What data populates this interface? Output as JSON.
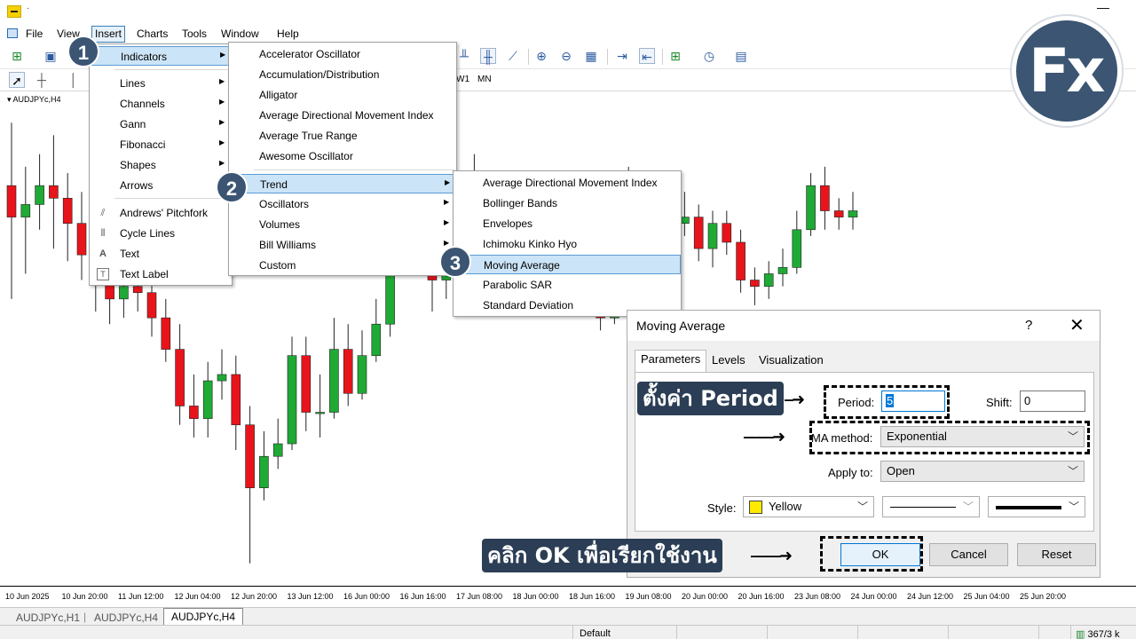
{
  "app": {
    "title_mark": "·"
  },
  "menubar": {
    "items": [
      "File",
      "View",
      "Insert",
      "Charts",
      "Tools",
      "Window",
      "Help"
    ]
  },
  "toolbar": {
    "timeframes": [
      "W1",
      "MN"
    ]
  },
  "chart": {
    "symbol": "AUDJPYc,H4",
    "time_ticks": [
      "10 Jun 2025",
      "10 Jun 20:00",
      "11 Jun 12:00",
      "12 Jun 04:00",
      "12 Jun 20:00",
      "13 Jun 12:00",
      "16 Jun 00:00",
      "16 Jun 16:00",
      "17 Jun 08:00",
      "18 Jun 00:00",
      "18 Jun 16:00",
      "19 Jun 08:00",
      "20 Jun 00:00",
      "20 Jun 16:00",
      "23 Jun 08:00",
      "24 Jun 00:00",
      "24 Jun 12:00",
      "25 Jun 04:00",
      "25 Jun 20:00"
    ],
    "colors": {
      "bull": "#1faa35",
      "bear": "#e8141b",
      "wick": "#222222"
    }
  },
  "tabs": [
    "AUDJPYc,H1",
    "AUDJPYc,H4",
    "AUDJPYc,H4"
  ],
  "status": {
    "profile": "Default",
    "traffic": "367/3 k"
  },
  "insert_menu": {
    "items": [
      "Indicators",
      "Lines",
      "Channels",
      "Gann",
      "Fibonacci",
      "Shapes",
      "Arrows",
      "Andrews' Pitchfork",
      "Cycle Lines",
      "Text",
      "Text Label"
    ]
  },
  "indicators_menu": {
    "items": [
      "Accelerator Oscillator",
      "Accumulation/Distribution",
      "Alligator",
      "Average Directional Movement Index",
      "Average True Range",
      "Awesome Oscillator",
      "Trend",
      "Oscillators",
      "Volumes",
      "Bill Williams",
      "Custom"
    ]
  },
  "trend_menu": {
    "items": [
      "Average Directional Movement Index",
      "Bollinger Bands",
      "Envelopes",
      "Ichimoku Kinko Hyo",
      "Moving Average",
      "Parabolic SAR",
      "Standard Deviation"
    ]
  },
  "steps": [
    "1",
    "2",
    "3"
  ],
  "logo": {
    "text": "Fx"
  },
  "dialog": {
    "title": "Moving Average",
    "help": "?",
    "close": "✕",
    "tabs": [
      "Parameters",
      "Levels",
      "Visualization"
    ],
    "period_label": "Period:",
    "period_value": "5",
    "shift_label": "Shift:",
    "shift_value": "0",
    "method_label": "MA method:",
    "method_value": "Exponential",
    "apply_label": "Apply to:",
    "apply_value": "Open",
    "style_label": "Style:",
    "style_color": "Yellow",
    "ok": "OK",
    "cancel": "Cancel",
    "reset": "Reset"
  },
  "annotations": {
    "period_note": "ตั้งค่า Period",
    "ok_note": "คลิก OK เพื่อเรียกใช้งาน"
  },
  "candles": [
    {
      "o": 110,
      "c": 105,
      "h": 120,
      "l": 92
    },
    {
      "o": 105,
      "c": 107,
      "h": 113,
      "l": 96
    },
    {
      "o": 107,
      "c": 110,
      "h": 115,
      "l": 103
    },
    {
      "o": 110,
      "c": 108,
      "h": 118,
      "l": 100
    },
    {
      "o": 108,
      "c": 104,
      "h": 112,
      "l": 98
    },
    {
      "o": 104,
      "c": 99,
      "h": 109,
      "l": 95
    },
    {
      "o": 99,
      "c": 95,
      "h": 104,
      "l": 90
    },
    {
      "o": 95,
      "c": 92,
      "h": 99,
      "l": 88
    },
    {
      "o": 92,
      "c": 94,
      "h": 98,
      "l": 89
    },
    {
      "o": 94,
      "c": 93,
      "h": 97,
      "l": 90
    },
    {
      "o": 93,
      "c": 89,
      "h": 96,
      "l": 86
    },
    {
      "o": 89,
      "c": 84,
      "h": 92,
      "l": 82
    },
    {
      "o": 84,
      "c": 75,
      "h": 88,
      "l": 72
    },
    {
      "o": 75,
      "c": 73,
      "h": 80,
      "l": 70
    },
    {
      "o": 73,
      "c": 79,
      "h": 82,
      "l": 70
    },
    {
      "o": 79,
      "c": 80,
      "h": 84,
      "l": 76
    },
    {
      "o": 80,
      "c": 72,
      "h": 83,
      "l": 68
    },
    {
      "o": 72,
      "c": 62,
      "h": 75,
      "l": 50
    },
    {
      "o": 62,
      "c": 67,
      "h": 71,
      "l": 60
    },
    {
      "o": 67,
      "c": 69,
      "h": 73,
      "l": 65
    },
    {
      "o": 69,
      "c": 83,
      "h": 86,
      "l": 68
    },
    {
      "o": 83,
      "c": 74,
      "h": 86,
      "l": 71
    },
    {
      "o": 74,
      "c": 74,
      "h": 80,
      "l": 70
    },
    {
      "o": 74,
      "c": 84,
      "h": 89,
      "l": 73
    },
    {
      "o": 84,
      "c": 77,
      "h": 88,
      "l": 75
    },
    {
      "o": 77,
      "c": 83,
      "h": 87,
      "l": 76
    },
    {
      "o": 83,
      "c": 88,
      "h": 92,
      "l": 82
    },
    {
      "o": 88,
      "c": 98,
      "h": 100,
      "l": 86
    },
    {
      "o": 98,
      "c": 104,
      "h": 108,
      "l": 96
    },
    {
      "o": 104,
      "c": 100,
      "h": 110,
      "l": 96
    },
    {
      "o": 100,
      "c": 95,
      "h": 104,
      "l": 90
    },
    {
      "o": 95,
      "c": 99,
      "h": 103,
      "l": 92
    },
    {
      "o": 99,
      "c": 100,
      "h": 104,
      "l": 96
    },
    {
      "o": 100,
      "c": 101,
      "h": 115,
      "l": 97
    },
    {
      "o": 101,
      "c": 97,
      "h": 106,
      "l": 94
    },
    {
      "o": 97,
      "c": 100,
      "h": 103,
      "l": 94
    },
    {
      "o": 100,
      "c": 100,
      "h": 104,
      "l": 96
    },
    {
      "o": 100,
      "c": 105,
      "h": 108,
      "l": 98
    },
    {
      "o": 105,
      "c": 96,
      "h": 108,
      "l": 93
    },
    {
      "o": 96,
      "c": 98,
      "h": 101,
      "l": 94
    },
    {
      "o": 98,
      "c": 99,
      "h": 102,
      "l": 95
    },
    {
      "o": 99,
      "c": 98,
      "h": 103,
      "l": 95
    },
    {
      "o": 98,
      "c": 89,
      "h": 101,
      "l": 87
    },
    {
      "o": 89,
      "c": 109,
      "h": 112,
      "l": 88
    },
    {
      "o": 109,
      "c": 105,
      "h": 113,
      "l": 100
    },
    {
      "o": 105,
      "c": 98,
      "h": 109,
      "l": 95
    },
    {
      "o": 98,
      "c": 90,
      "h": 101,
      "l": 87
    },
    {
      "o": 90,
      "c": 104,
      "h": 107,
      "l": 88
    },
    {
      "o": 104,
      "c": 105,
      "h": 109,
      "l": 102
    },
    {
      "o": 105,
      "c": 100,
      "h": 107,
      "l": 98
    },
    {
      "o": 100,
      "c": 104,
      "h": 106,
      "l": 97
    },
    {
      "o": 104,
      "c": 101,
      "h": 106,
      "l": 99
    },
    {
      "o": 101,
      "c": 95,
      "h": 103,
      "l": 93
    },
    {
      "o": 95,
      "c": 94,
      "h": 97,
      "l": 91
    },
    {
      "o": 94,
      "c": 96,
      "h": 98,
      "l": 92
    },
    {
      "o": 96,
      "c": 97,
      "h": 100,
      "l": 94
    },
    {
      "o": 97,
      "c": 103,
      "h": 106,
      "l": 96
    },
    {
      "o": 103,
      "c": 110,
      "h": 112,
      "l": 102
    },
    {
      "o": 110,
      "c": 106,
      "h": 113,
      "l": 103
    },
    {
      "o": 106,
      "c": 105,
      "h": 108,
      "l": 103
    },
    {
      "o": 105,
      "c": 106,
      "h": 109,
      "l": 103
    }
  ]
}
